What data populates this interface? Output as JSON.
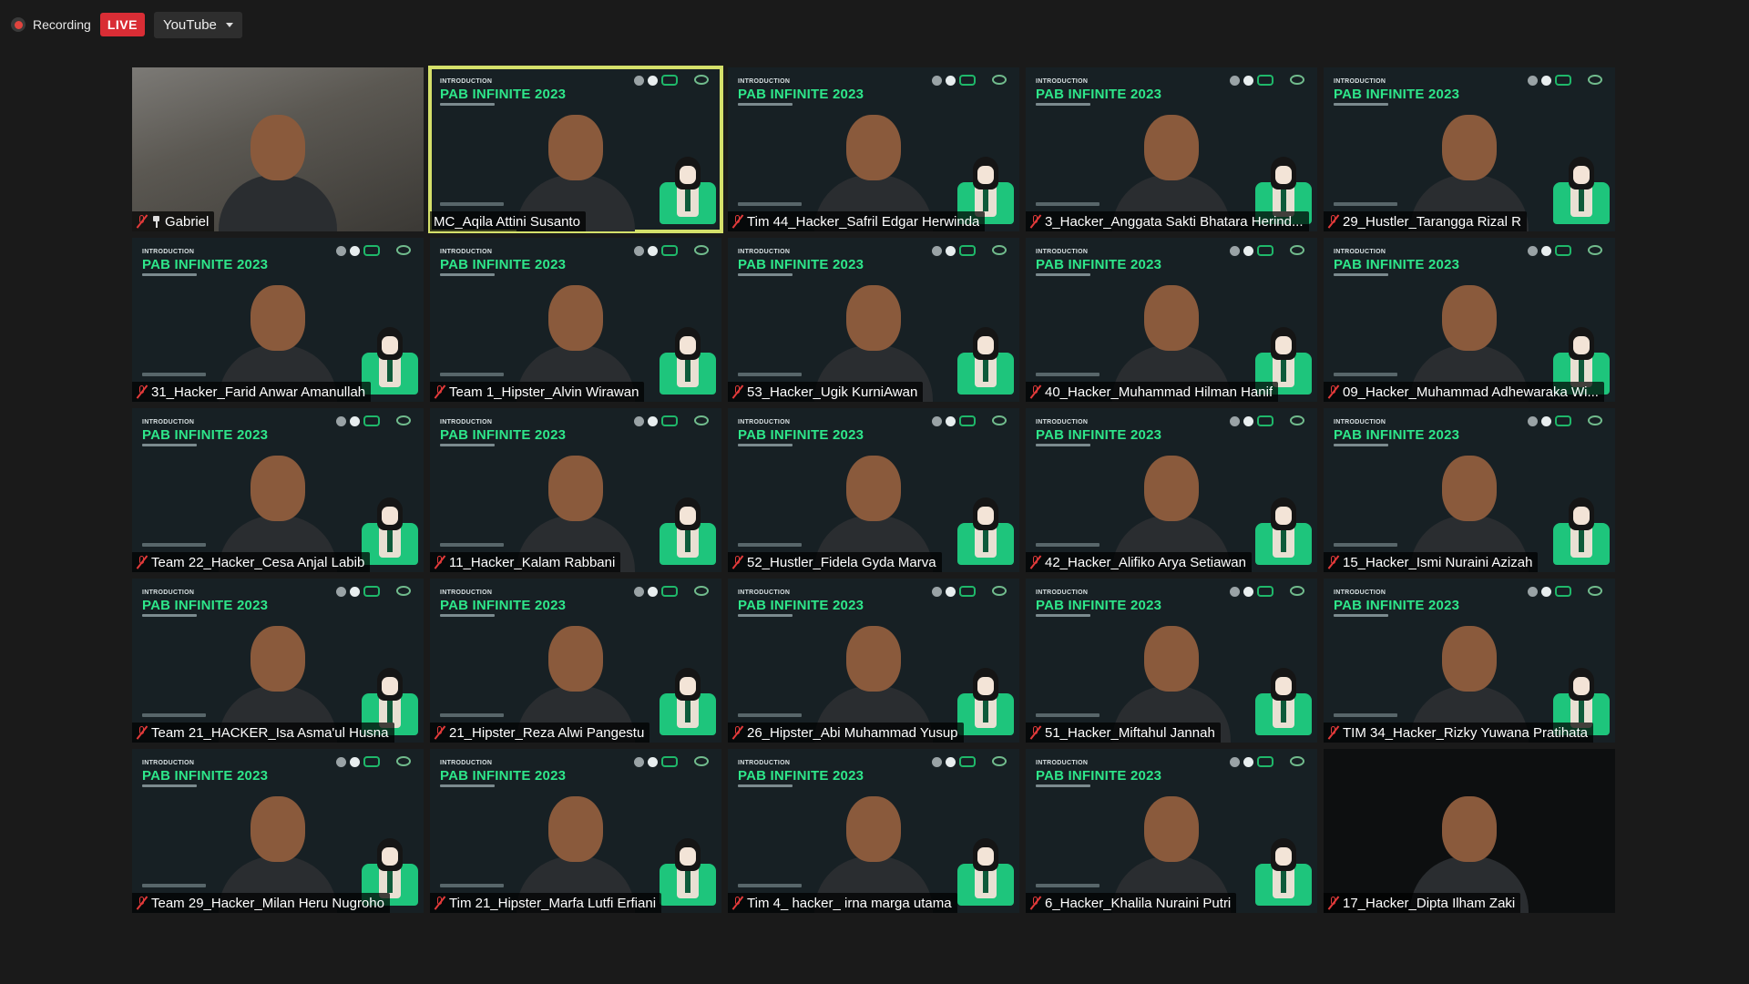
{
  "topbar": {
    "recording_label": "Recording",
    "live_label": "LIVE",
    "stream_target": "YouTube"
  },
  "slide": {
    "intro_label": "INTRODUCTION",
    "title": "PAB INFINITE 2023"
  },
  "colors": {
    "background": "#1a1a1a",
    "live_red": "#d92d35",
    "active_speaker_border": "#d5e06a",
    "slide_accent": "#2ee68a",
    "muted_mic": "#e23a3a"
  },
  "participants": [
    {
      "name": "Gabriel",
      "muted": true,
      "pinned": true,
      "type": "camera"
    },
    {
      "name": "MC_Aqila Attini Susanto",
      "muted": false,
      "active": true,
      "type": "slide"
    },
    {
      "name": "Tim 44_Hacker_Safril Edgar Herwinda",
      "muted": true,
      "type": "slide"
    },
    {
      "name": "3_Hacker_Anggata Sakti Bhatara Herind...",
      "muted": true,
      "type": "slide"
    },
    {
      "name": "29_Hustler_Tarangga Rizal R",
      "muted": true,
      "type": "slide"
    },
    {
      "name": "31_Hacker_Farid Anwar Amanullah",
      "muted": true,
      "type": "slide"
    },
    {
      "name": "Team 1_Hipster_Alvin Wirawan",
      "muted": true,
      "type": "slide"
    },
    {
      "name": "53_Hacker_Ugik KurniAwan",
      "muted": true,
      "type": "slide"
    },
    {
      "name": "40_Hacker_Muhammad Hilman Hanif",
      "muted": true,
      "type": "slide"
    },
    {
      "name": "09_Hacker_Muhammad Adhewaraka Wi...",
      "muted": true,
      "type": "slide"
    },
    {
      "name": "Team 22_Hacker_Cesa Anjal Labib",
      "muted": true,
      "type": "slide"
    },
    {
      "name": "11_Hacker_Kalam Rabbani",
      "muted": true,
      "type": "slide"
    },
    {
      "name": "52_Hustler_Fidela Gyda Marva",
      "muted": true,
      "type": "slide"
    },
    {
      "name": "42_Hacker_Alifiko Arya Setiawan",
      "muted": true,
      "type": "slide"
    },
    {
      "name": "15_Hacker_Ismi Nuraini Azizah",
      "muted": true,
      "type": "slide"
    },
    {
      "name": "Team 21_HACKER_Isa Asma'ul Husna",
      "muted": true,
      "type": "slide"
    },
    {
      "name": "21_Hipster_Reza Alwi Pangestu",
      "muted": true,
      "type": "slide"
    },
    {
      "name": "26_Hipster_Abi Muhammad Yusup",
      "muted": true,
      "type": "slide"
    },
    {
      "name": "51_Hacker_Miftahul Jannah",
      "muted": true,
      "type": "slide"
    },
    {
      "name": "TIM 34_Hacker_Rizky Yuwana Pratihata",
      "muted": true,
      "type": "slide"
    },
    {
      "name": "Team 29_Hacker_Milan Heru Nugroho",
      "muted": true,
      "type": "slide"
    },
    {
      "name": "Tim 21_Hipster_Marfa Lutfi Erfiani",
      "muted": true,
      "type": "slide"
    },
    {
      "name": "Tim 4_ hacker_ irna marga utama",
      "muted": true,
      "type": "slide"
    },
    {
      "name": "6_Hacker_Khalila Nuraini Putri",
      "muted": true,
      "type": "slide"
    },
    {
      "name": "17_Hacker_Dipta Ilham Zaki",
      "muted": true,
      "type": "dark"
    }
  ]
}
